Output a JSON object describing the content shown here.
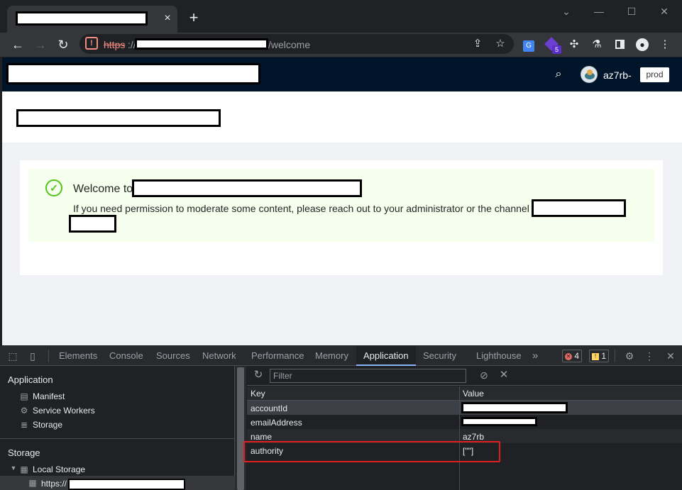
{
  "browser": {
    "tab_close": "×",
    "new_tab": "+",
    "window_controls": {
      "collapse": "⌄",
      "minimize": "—",
      "maximize": "☐",
      "close": "✕"
    },
    "back": "←",
    "forward": "→",
    "reload": "↻",
    "address": {
      "scheme": "https",
      "slash": "://",
      "path": "/welcome"
    },
    "extensions": {
      "badge": "5"
    }
  },
  "app": {
    "header": {
      "username": "az7rb-",
      "env_tag": "prod"
    },
    "welcome": {
      "title": "Welcome to",
      "message": "If you need permission to moderate some content, please reach out to your administrator or the channel"
    }
  },
  "devtools": {
    "tabs": [
      "Elements",
      "Console",
      "Sources",
      "Network",
      "Performance",
      "Memory",
      "Application",
      "Security",
      "Lighthouse"
    ],
    "active_tab": "Application",
    "more_tabs": "»",
    "errors": "4",
    "warnings": "1",
    "sidebar": {
      "application_heading": "Application",
      "application_items": [
        "Manifest",
        "Service Workers",
        "Storage"
      ],
      "storage_heading": "Storage",
      "local_storage": "Local Storage",
      "origin_prefix": "https://"
    },
    "filter_placeholder": "Filter",
    "table": {
      "columns": [
        "Key",
        "Value"
      ],
      "rows": [
        {
          "key": "accountId",
          "value": ""
        },
        {
          "key": "emailAddress",
          "value": ""
        },
        {
          "key": "name",
          "value": "az7rb"
        },
        {
          "key": "authority",
          "value": "[\"\"]"
        }
      ]
    }
  },
  "colors": {
    "app_header": "#001529",
    "success": "#52c41a",
    "highlight": "#e02020",
    "devtools_accent": "#8ab4f8"
  }
}
